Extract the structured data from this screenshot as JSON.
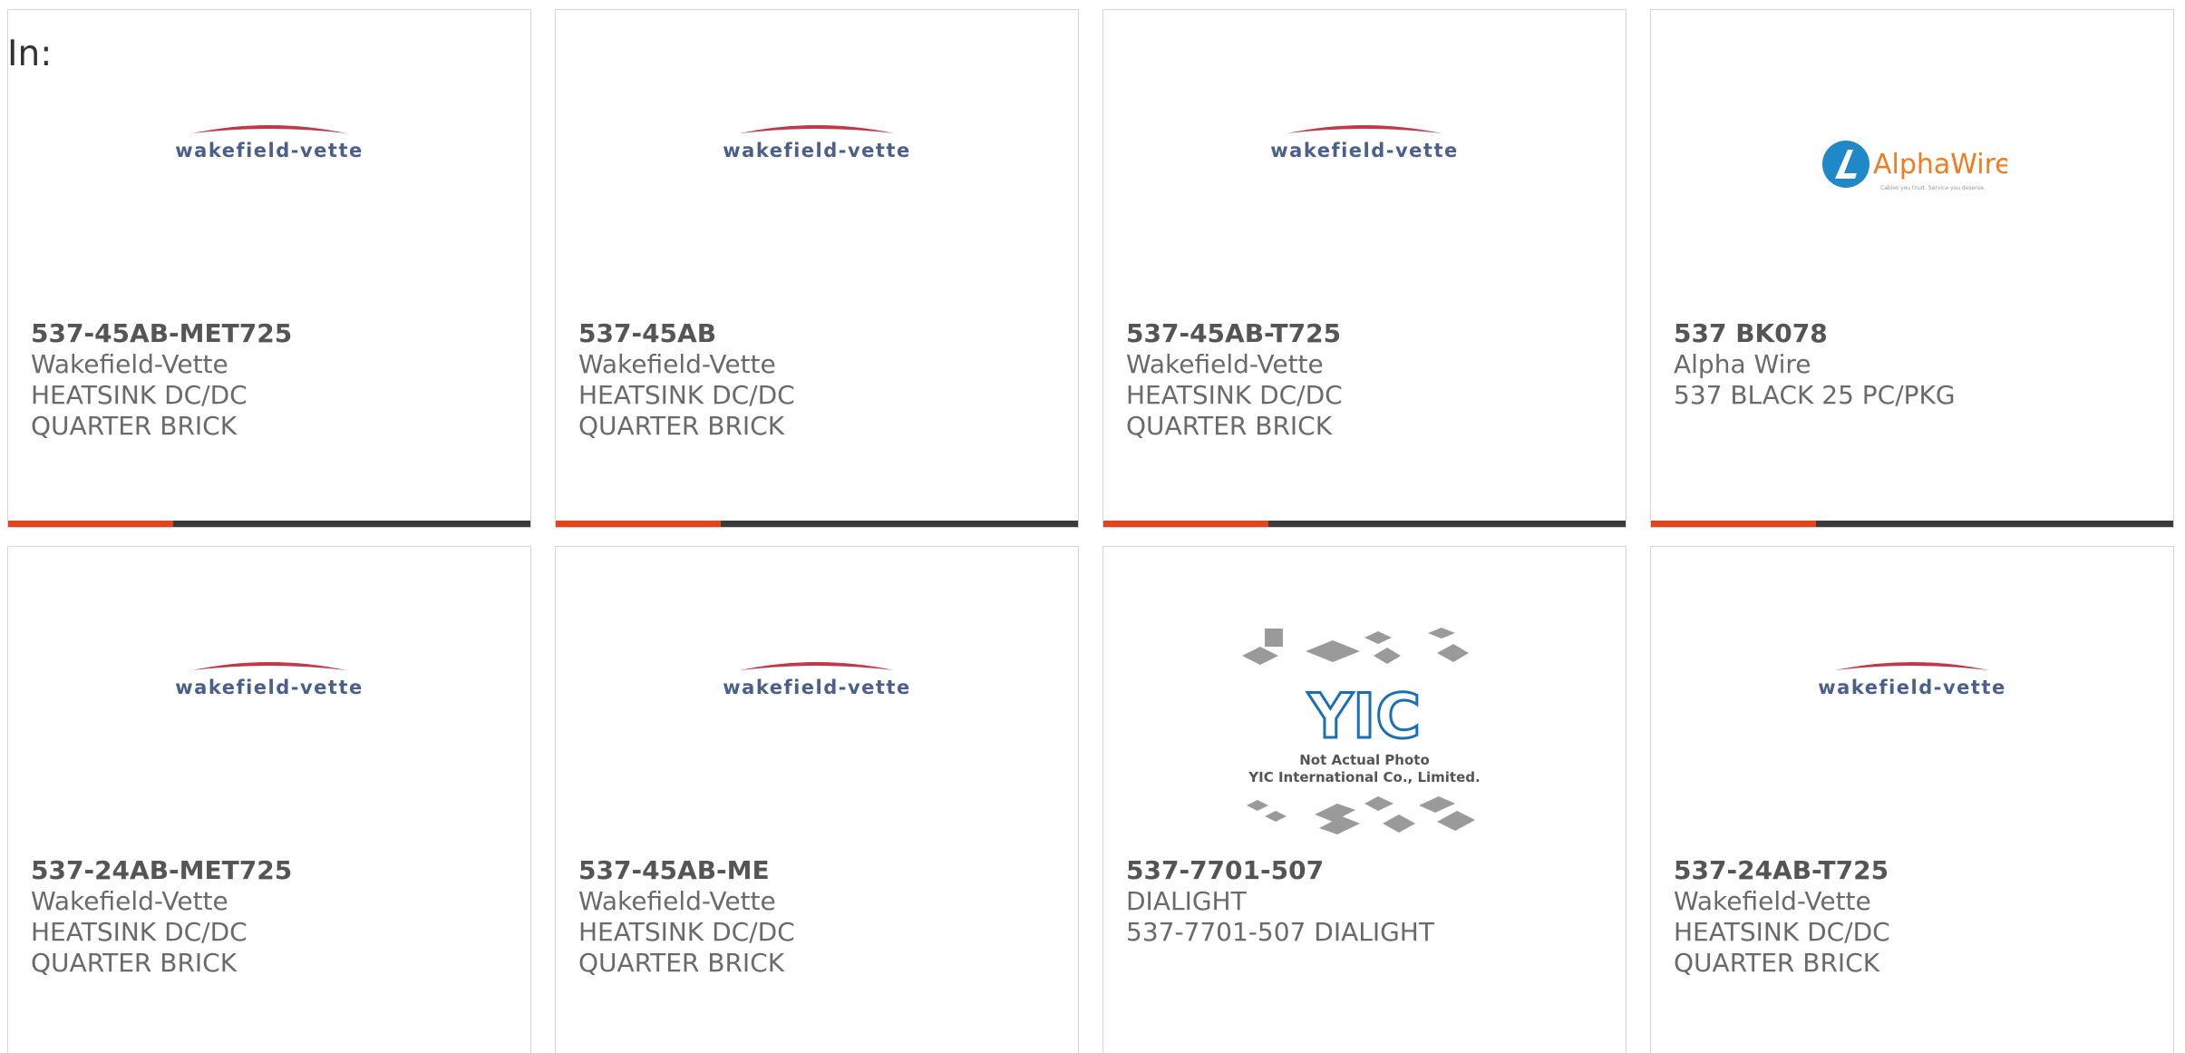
{
  "filter": {
    "in_label": "In:"
  },
  "brand_colors": {
    "accent": "#e8421a",
    "bar": "#3b3b3b",
    "wakefield_red": "#c0394b",
    "wakefield_blue": "#4a5f8a",
    "alphawire_orange": "#f07c20",
    "alphawire_blue": "#1e88c8",
    "yic_blue": "#1a6fb5"
  },
  "products": [
    {
      "part": "537-45AB-MET725",
      "manufacturer": "Wakefield-Vette",
      "description": "HEATSINK DC/DC QUARTER BRICK",
      "logo": "wakefield-vette-logo"
    },
    {
      "part": "537-45AB",
      "manufacturer": "Wakefield-Vette",
      "description": "HEATSINK DC/DC QUARTER BRICK",
      "logo": "wakefield-vette-logo"
    },
    {
      "part": "537-45AB-T725",
      "manufacturer": "Wakefield-Vette",
      "description": "HEATSINK DC/DC QUARTER BRICK",
      "logo": "wakefield-vette-logo"
    },
    {
      "part": "537 BK078",
      "manufacturer": "Alpha Wire",
      "description": "537 BLACK 25 PC/PKG",
      "logo": "alphawire-logo"
    },
    {
      "part": "537-24AB-MET725",
      "manufacturer": "Wakefield-Vette",
      "description": "HEATSINK DC/DC QUARTER BRICK",
      "logo": "wakefield-vette-logo"
    },
    {
      "part": "537-45AB-ME",
      "manufacturer": "Wakefield-Vette",
      "description": "HEATSINK DC/DC QUARTER BRICK",
      "logo": "wakefield-vette-logo"
    },
    {
      "part": "537-7701-507",
      "manufacturer": "DIALIGHT",
      "description": "537-7701-507 DIALIGHT",
      "logo": "yic-placeholder-image"
    },
    {
      "part": "537-24AB-T725",
      "manufacturer": "Wakefield-Vette",
      "description": "HEATSINK DC/DC QUARTER BRICK",
      "logo": "wakefield-vette-logo"
    }
  ],
  "logos": {
    "wakefield_text": "wakefield-vette",
    "alphawire_text": "AlphaWire",
    "alphawire_tagline": "Cables you trust. Service you deserve.",
    "yic_mark": "YIC",
    "yic_line1": "Not Actual Photo",
    "yic_line2": "YIC International Co., Limited."
  }
}
